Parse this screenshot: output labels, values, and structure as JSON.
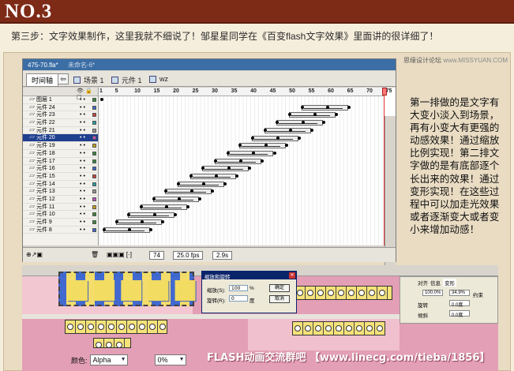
{
  "header": {
    "title": "NO.3",
    "step_text": "第三步：文字效果制作，这里我就不细说了！邹星星同学在《百变flash文字效果》里面讲的很详细了！"
  },
  "watermark": {
    "text": "思缘设计论坛",
    "url": "www.MISSYUAN.COM"
  },
  "flash": {
    "doc_tabs": [
      "475-70.fla*",
      "未命名-6*"
    ],
    "timeline_button": "时间轴",
    "breadcrumb": [
      "场景 1",
      "元件 1",
      "wz"
    ],
    "layers": [
      "图层 1",
      "元件 24",
      "元件 23",
      "元件 22",
      "元件 21",
      "元件 20",
      "元件 19",
      "元件 18",
      "元件 17",
      "元件 16",
      "元件 15",
      "元件 14",
      "元件 13",
      "元件 12",
      "元件 11",
      "元件 10",
      "元件 9",
      "元件 8"
    ],
    "selected_layer": "元件 20",
    "ruler_numbers": [
      "1",
      "5",
      "10",
      "15",
      "20",
      "25",
      "30",
      "35",
      "40",
      "45",
      "50",
      "55",
      "60",
      "65",
      "70",
      "75"
    ],
    "status": {
      "frame": "74",
      "fps": "25.0 fps",
      "time": "2.9s"
    }
  },
  "note": "第一排做的是文字有大变小淡入到场景，再有小变大有更强的动感效果！通过缩放比例实现！第二排文字做的是有底部逐个长出来的效果！通过变形实现！在这些过程中可以加走光效果或者逐渐变大或者变小来增加动感！",
  "dialog": {
    "title": "缩放和旋转",
    "scale_label": "缩放(S):",
    "scale_value": "100",
    "scale_unit": "%",
    "rotate_label": "旋转(R):",
    "rotate_value": "0",
    "rotate_unit": "度",
    "ok": "确定",
    "cancel": "取消"
  },
  "transform_panel": {
    "tabs": [
      "对齐",
      "信息",
      "变形"
    ],
    "width_value": "100.0%",
    "height_value": "34.9%",
    "constrain": "约束",
    "rotate_label": "旋转",
    "rotate_value": "0.0度",
    "skew_label": "倾斜",
    "skew_value": "0.0度"
  },
  "color_row": {
    "label": "颜色:",
    "mode": "Alpha",
    "value": "0%"
  },
  "footer_text": "FLASH动画交流群吧 【www.linecg.com/tieba/1856】"
}
